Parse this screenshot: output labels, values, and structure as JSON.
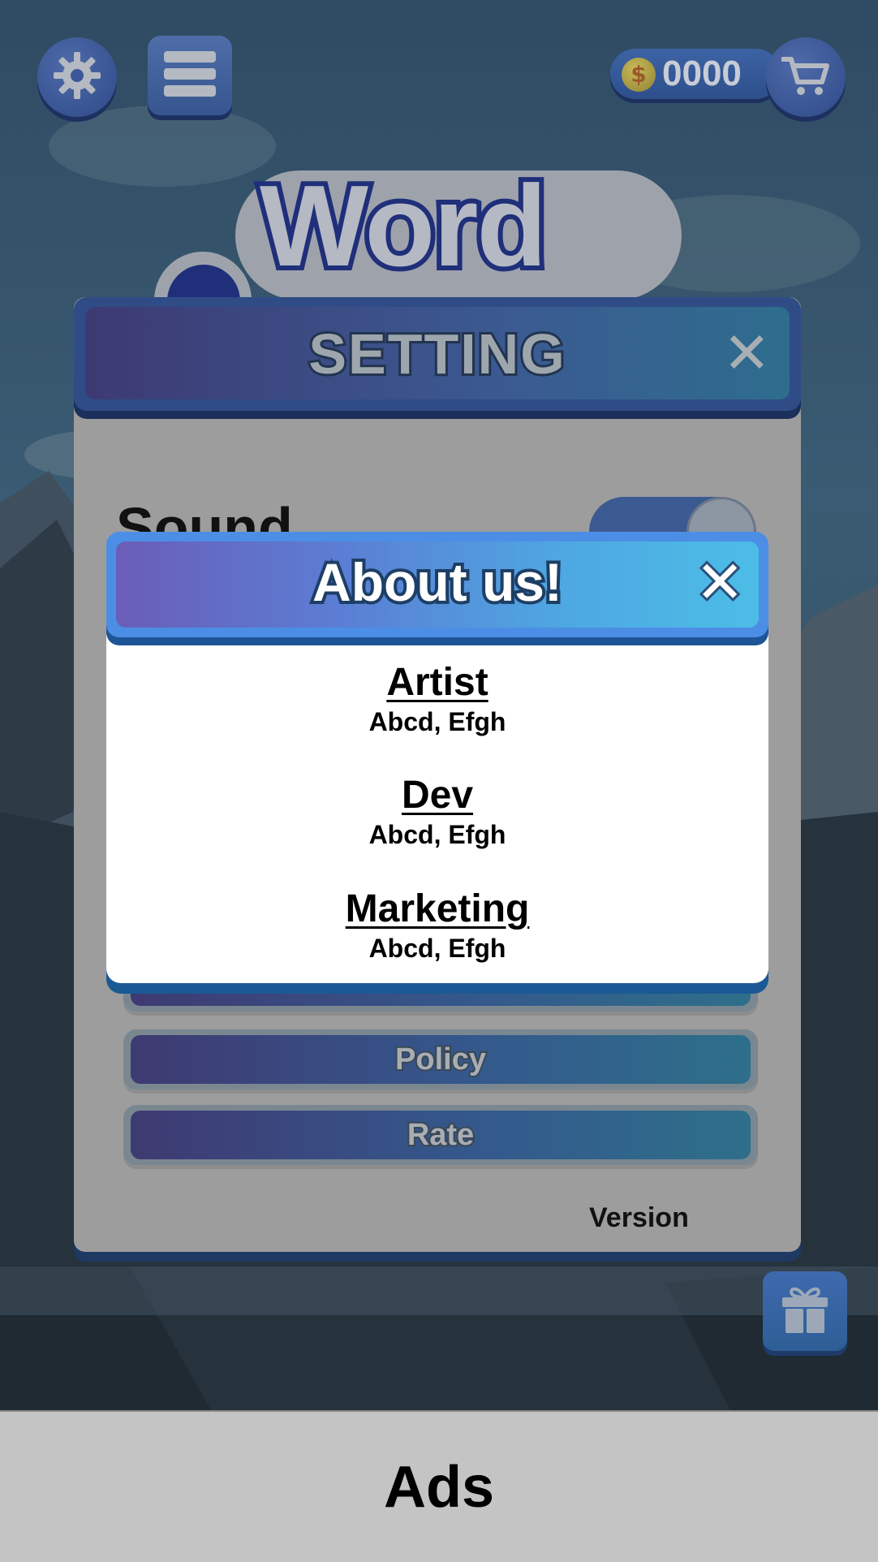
{
  "hud": {
    "coins": "0000",
    "coin_symbol": "$"
  },
  "logo": {
    "word": "Word"
  },
  "setting": {
    "title": "SETTING",
    "close": "✕",
    "sound_label": "Sound",
    "sound_enabled": true,
    "buttons": [
      {
        "label": "Policy"
      },
      {
        "label": "Rate"
      }
    ],
    "version_label": "Version"
  },
  "about": {
    "title": "About us!",
    "close": "✕",
    "credits": [
      {
        "role": "Artist",
        "names": "Abcd, Efgh"
      },
      {
        "role": "Dev",
        "names": "Abcd, Efgh"
      },
      {
        "role": "Marketing",
        "names": "Abcd, Efgh"
      }
    ]
  },
  "ads": {
    "label": "Ads"
  },
  "icons": {
    "settings": "gear-icon",
    "menu": "menu-icon",
    "cart": "cart-icon",
    "gift": "gift-icon",
    "coin": "coin-icon"
  },
  "colors": {
    "about_header_start": "#6a5db8",
    "about_header_end": "#4cbde6",
    "setting_panel": "#9d9d9d",
    "ads_bar": "#c4c4c4"
  }
}
